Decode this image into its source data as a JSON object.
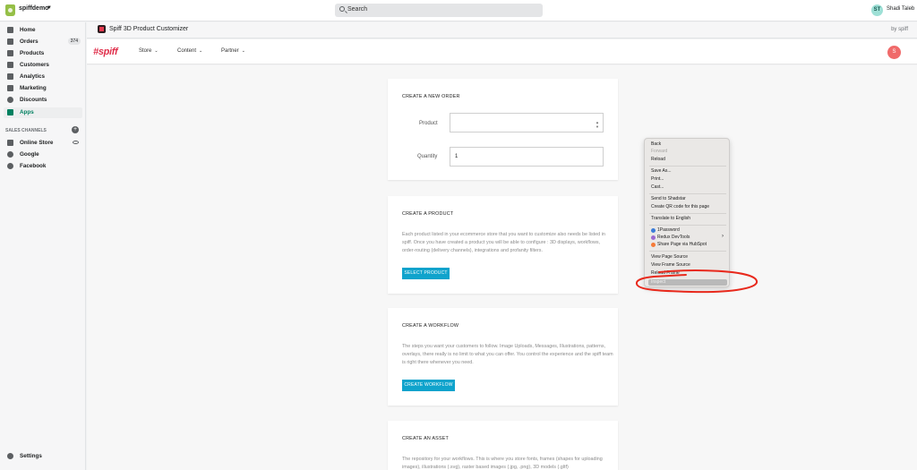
{
  "topbar": {
    "store_name": "spiffdemo",
    "search_label": "Search",
    "avatar_initials": "ST",
    "user_name": "Shadi Taleb"
  },
  "sidebar": {
    "items": [
      {
        "label": "Home",
        "icon": "home-icon"
      },
      {
        "label": "Orders",
        "icon": "orders-icon",
        "badge": "374"
      },
      {
        "label": "Products",
        "icon": "tag-icon"
      },
      {
        "label": "Customers",
        "icon": "person-icon"
      },
      {
        "label": "Analytics",
        "icon": "bar-chart-icon"
      },
      {
        "label": "Marketing",
        "icon": "megaphone-icon"
      },
      {
        "label": "Discounts",
        "icon": "discount-icon"
      },
      {
        "label": "Apps",
        "icon": "apps-icon",
        "active": true
      }
    ],
    "sales_channels_header": "SALES CHANNELS",
    "channels": [
      {
        "label": "Online Store",
        "icon": "store-icon"
      },
      {
        "label": "Google",
        "icon": "google-icon"
      },
      {
        "label": "Facebook",
        "icon": "facebook-icon"
      }
    ],
    "settings_label": "Settings"
  },
  "app_header": {
    "title": "Spiff 3D Product Customizer",
    "by": "by spiff"
  },
  "spiff_nav": {
    "logo": "#spiff",
    "menu": [
      "Store",
      "Content",
      "Partner"
    ],
    "avatar": "S"
  },
  "cards": {
    "order": {
      "title": "CREATE A NEW ORDER",
      "product_label": "Product",
      "product_value": "",
      "quantity_label": "Quantity",
      "quantity_value": "1"
    },
    "product": {
      "title": "CREATE A PRODUCT",
      "text": "Each product listed in your ecommerce store that you want to customize also needs be listed in spiff. Once you have created a product you will be able to configure : 3D displays, workflows, order-routing (delivery channels), integrations and profanity filters.",
      "button": "SELECT PRODUCT"
    },
    "workflow": {
      "title": "CREATE A WORKFLOW",
      "text": "The steps you want your customers to follow. Image Uploads, Messages, Illustrations, patterns, overlays, there really is no limit to what you can offer. You control the experience and the spiff team is right there whenever you need.",
      "button": "CREATE WORKFLOW"
    },
    "asset": {
      "title": "CREATE AN ASSET",
      "text": "The repository for your workflows. This is where you store fonts, frames (shapes for uploading images), illustrations (.svg), raster based images (.jpg, .png), 3D models (.gltf)"
    }
  },
  "context_menu": {
    "items": [
      {
        "label": "Back"
      },
      {
        "label": "Forward",
        "disabled": true
      },
      {
        "label": "Reload"
      },
      {
        "label": "Save As..."
      },
      {
        "label": "Print..."
      },
      {
        "label": "Cast..."
      },
      {
        "label": "Send to Shadstar"
      },
      {
        "label": "Create QR code for this page"
      },
      {
        "label": "Translate to English"
      },
      {
        "label": "1Password",
        "icon": "1password-icon"
      },
      {
        "label": "Redux DevTools",
        "icon": "redux-icon",
        "submenu": true
      },
      {
        "label": "Share Page via HubSpot",
        "icon": "hubspot-icon"
      },
      {
        "label": "View Page Source"
      },
      {
        "label": "View Frame Source"
      },
      {
        "label": "Reload Frame"
      },
      {
        "label": "Inspect",
        "highlighted": true
      }
    ]
  },
  "colors": {
    "accent": "#0fa3cc",
    "brand": "#e02f4b",
    "annotation": "#e8291c",
    "active_nav": "#008060"
  }
}
